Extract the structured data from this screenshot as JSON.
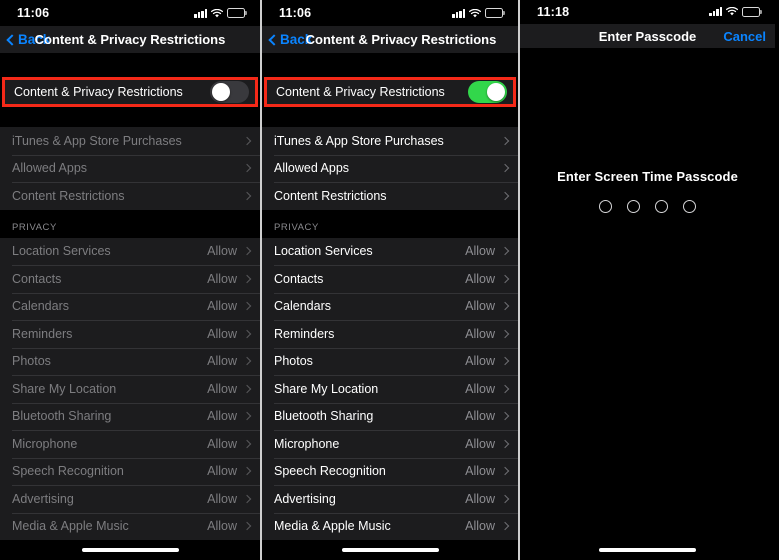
{
  "accent": {
    "blue": "#0a84ff",
    "green": "#32d74b",
    "highlight_red": "#f42918",
    "row_bg": "#1c1c1e",
    "screen_bg": "#000000"
  },
  "panels": [
    {
      "id": "restrictions-off",
      "status_bar": {
        "time": "11:06",
        "icons": [
          "cellular-signal-icon",
          "wifi-icon",
          "battery-icon"
        ]
      },
      "nav": {
        "back_label": "Back",
        "title": "Content & Privacy Restrictions"
      },
      "toggle_row": {
        "label": "Content & Privacy Restrictions",
        "state": "off",
        "highlighted": true
      },
      "menu_rows": [
        {
          "label": "iTunes & App Store Purchases",
          "value": "",
          "chevron": true
        },
        {
          "label": "Allowed Apps",
          "value": "",
          "chevron": true
        },
        {
          "label": "Content Restrictions",
          "value": "",
          "chevron": true
        }
      ],
      "privacy_header": "PRIVACY",
      "privacy_rows": [
        {
          "label": "Location Services",
          "value": "Allow",
          "chevron": true
        },
        {
          "label": "Contacts",
          "value": "Allow",
          "chevron": true
        },
        {
          "label": "Calendars",
          "value": "Allow",
          "chevron": true
        },
        {
          "label": "Reminders",
          "value": "Allow",
          "chevron": true
        },
        {
          "label": "Photos",
          "value": "Allow",
          "chevron": true
        },
        {
          "label": "Share My Location",
          "value": "Allow",
          "chevron": true
        },
        {
          "label": "Bluetooth Sharing",
          "value": "Allow",
          "chevron": true
        },
        {
          "label": "Microphone",
          "value": "Allow",
          "chevron": true
        },
        {
          "label": "Speech Recognition",
          "value": "Allow",
          "chevron": true
        },
        {
          "label": "Advertising",
          "value": "Allow",
          "chevron": true
        },
        {
          "label": "Media & Apple Music",
          "value": "Allow",
          "chevron": true
        }
      ],
      "dimmed": true
    },
    {
      "id": "restrictions-on",
      "status_bar": {
        "time": "11:06",
        "icons": [
          "cellular-signal-icon",
          "wifi-icon",
          "battery-icon"
        ]
      },
      "nav": {
        "back_label": "Back",
        "title": "Content & Privacy Restrictions"
      },
      "toggle_row": {
        "label": "Content & Privacy Restrictions",
        "state": "on",
        "highlighted": true
      },
      "menu_rows": [
        {
          "label": "iTunes & App Store Purchases",
          "value": "",
          "chevron": true
        },
        {
          "label": "Allowed Apps",
          "value": "",
          "chevron": true
        },
        {
          "label": "Content Restrictions",
          "value": "",
          "chevron": true
        }
      ],
      "privacy_header": "PRIVACY",
      "privacy_rows": [
        {
          "label": "Location Services",
          "value": "Allow",
          "chevron": true
        },
        {
          "label": "Contacts",
          "value": "Allow",
          "chevron": true
        },
        {
          "label": "Calendars",
          "value": "Allow",
          "chevron": true
        },
        {
          "label": "Reminders",
          "value": "Allow",
          "chevron": true
        },
        {
          "label": "Photos",
          "value": "Allow",
          "chevron": true
        },
        {
          "label": "Share My Location",
          "value": "Allow",
          "chevron": true
        },
        {
          "label": "Bluetooth Sharing",
          "value": "Allow",
          "chevron": true
        },
        {
          "label": "Microphone",
          "value": "Allow",
          "chevron": true
        },
        {
          "label": "Speech Recognition",
          "value": "Allow",
          "chevron": true
        },
        {
          "label": "Advertising",
          "value": "Allow",
          "chevron": true
        },
        {
          "label": "Media & Apple Music",
          "value": "Allow",
          "chevron": true
        }
      ],
      "dimmed": false
    },
    {
      "id": "enter-passcode",
      "status_bar": {
        "time": "11:18",
        "icons": [
          "cellular-signal-icon",
          "wifi-icon",
          "battery-icon"
        ]
      },
      "nav": {
        "title": "Enter Passcode",
        "right_label": "Cancel"
      },
      "passcode": {
        "prompt": "Enter Screen Time Passcode",
        "digit_count": 4,
        "entered": 0
      }
    }
  ]
}
